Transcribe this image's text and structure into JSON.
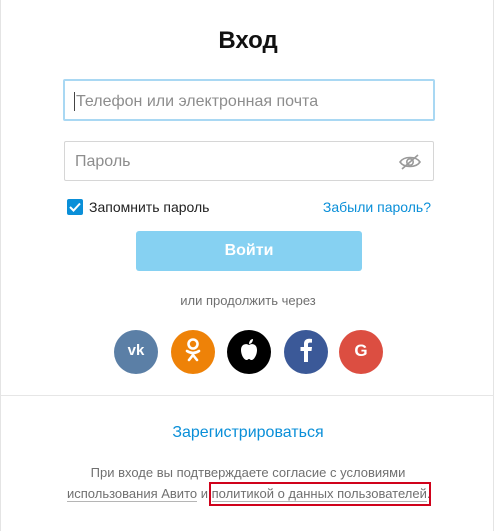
{
  "page": {
    "title": "Вход"
  },
  "login_field": {
    "placeholder": "Телефон или электронная почта"
  },
  "password_field": {
    "placeholder": "Пароль"
  },
  "remember": {
    "label": "Запомнить пароль",
    "checked": true
  },
  "forgot": {
    "label": "Забыли пароль?"
  },
  "login_button": {
    "label": "Войти"
  },
  "social": {
    "caption": "или продолжить через",
    "items": [
      {
        "name": "vk",
        "icon": "vk-icon",
        "color": "#5b7fa6"
      },
      {
        "name": "odnoklassniki",
        "icon": "ok-icon",
        "color": "#ee8208"
      },
      {
        "name": "apple",
        "icon": "apple-icon",
        "color": "#000000"
      },
      {
        "name": "facebook",
        "icon": "facebook-icon",
        "color": "#3b5998"
      },
      {
        "name": "google",
        "icon": "google-icon",
        "color": "#dc4e41"
      }
    ]
  },
  "register": {
    "label": "Зарегистрироваться"
  },
  "terms": {
    "line1": "При входе вы подтверждаете согласие с условиями",
    "link1": "использования Авито",
    "connector": " и ",
    "link2": "политикой о данных пользователей",
    "end": "."
  },
  "colors": {
    "accent": "#0a8fd8",
    "button_disabled": "#86d1f2",
    "highlight": "#d0021b"
  }
}
